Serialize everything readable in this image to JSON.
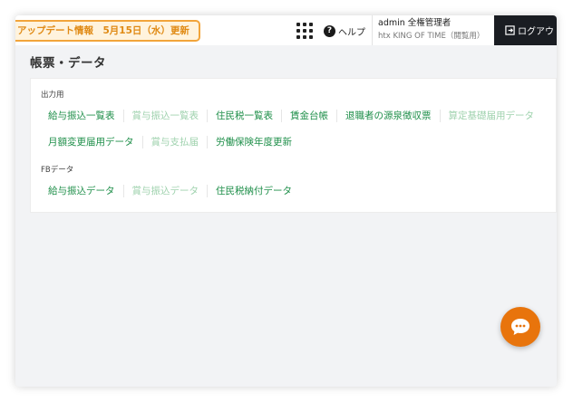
{
  "banner": {
    "text": "アップデート情報　5月15日（水）更新"
  },
  "header": {
    "help_label": "ヘルプ",
    "user_name": "admin 全権管理者",
    "user_sub": "htx KING OF TIME（閲覧用）",
    "logout_label": "ログアウ"
  },
  "page": {
    "title": "帳票・データ"
  },
  "sections": {
    "output": {
      "label": "出力用",
      "row1": [
        "給与振込一覧表",
        "賞与振込一覧表",
        "住民税一覧表",
        "賃金台帳",
        "退職者の源泉徴収票",
        "算定基礎届用データ"
      ],
      "row2": [
        "月額変更届用データ",
        "賞与支払届",
        "労働保険年度更新"
      ]
    },
    "fb": {
      "label": "FBデータ",
      "row1": [
        "給与振込データ",
        "賞与振込データ",
        "住民税納付データ"
      ]
    }
  },
  "colors": {
    "link_enabled": "#1f8f4a",
    "link_disabled": "#9fd2ae",
    "accent": "#e8740c",
    "banner_border": "#f2a43a"
  }
}
